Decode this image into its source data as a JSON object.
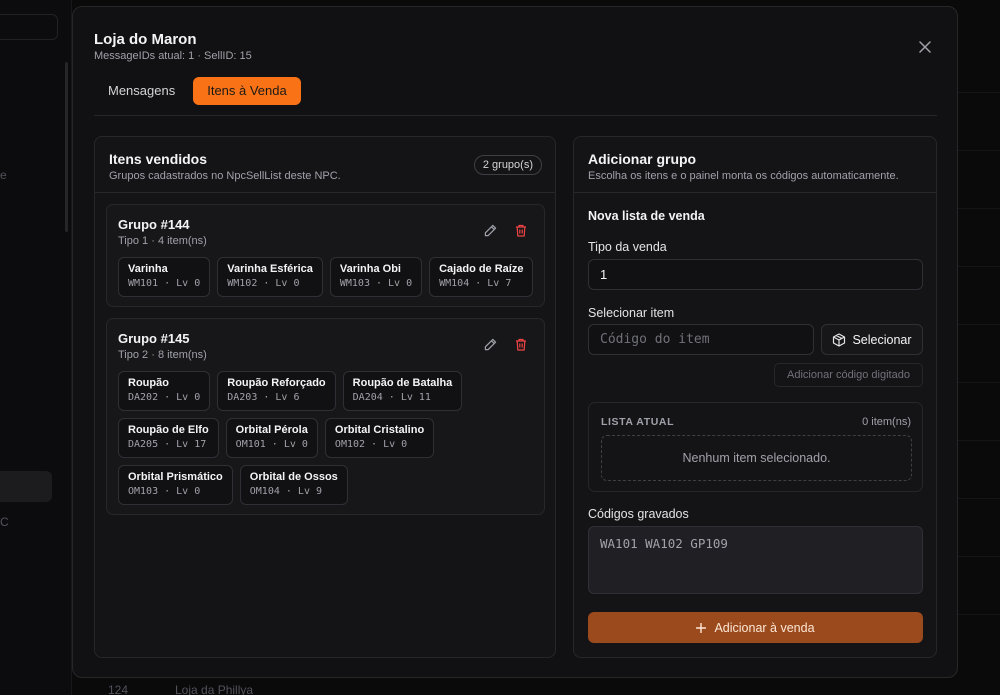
{
  "background": {
    "fragment_left_1": "e",
    "fragment_left_2": "C",
    "row": {
      "id": "124",
      "name": "Loja da Phillya"
    }
  },
  "modal": {
    "title": "Loja do Maron",
    "subtitle": "MessageIDs atual: 1 · SellID: 15",
    "tabs": [
      "Mensagens",
      "Itens à Venda"
    ],
    "active_tab": "Itens à Venda"
  },
  "left": {
    "title": "Itens vendidos",
    "subtitle": "Grupos cadastrados no NpcSellList deste NPC.",
    "badge": "2 grupo(s)",
    "groups": [
      {
        "title": "Grupo #144",
        "subtitle": "Tipo 1 · 4 item(ns)",
        "items": [
          {
            "name": "Varinha",
            "meta": "WM101 · Lv 0"
          },
          {
            "name": "Varinha Esférica",
            "meta": "WM102 · Lv 0"
          },
          {
            "name": "Varinha Obi",
            "meta": "WM103 · Lv 0"
          },
          {
            "name": "Cajado de Raíze",
            "meta": "WM104 · Lv 7"
          }
        ]
      },
      {
        "title": "Grupo #145",
        "subtitle": "Tipo 2 · 8 item(ns)",
        "items": [
          {
            "name": "Roupão",
            "meta": "DA202 · Lv 0"
          },
          {
            "name": "Roupão Reforçado",
            "meta": "DA203 · Lv 6"
          },
          {
            "name": "Roupão de Batalha",
            "meta": "DA204 · Lv 11"
          },
          {
            "name": "Roupão de Elfo",
            "meta": "DA205 · Lv 17"
          },
          {
            "name": "Orbital Pérola",
            "meta": "OM101 · Lv 0"
          },
          {
            "name": "Orbital Cristalino",
            "meta": "OM102 · Lv 0"
          },
          {
            "name": "Orbital Prismático",
            "meta": "OM103 · Lv 0"
          },
          {
            "name": "Orbital de Ossos",
            "meta": "OM104 · Lv 9"
          }
        ]
      }
    ]
  },
  "right": {
    "title": "Adicionar grupo",
    "subtitle": "Escolha os itens e o painel monta os códigos automaticamente.",
    "section_title": "Nova lista de venda",
    "tipo_label": "Tipo da venda",
    "tipo_value": "1",
    "item_label": "Selecionar item",
    "item_placeholder": "Código do item",
    "select_button": "Selecionar",
    "add_code_button": "Adicionar código digitado",
    "list_header": "LISTA ATUAL",
    "list_count": "0 item(ns)",
    "list_empty": "Nenhum item selecionado.",
    "codes_label": "Códigos gravados",
    "codes_placeholder": "WA101 WA102 GP109",
    "submit_button": "Adicionar à venda"
  },
  "colors": {
    "accent": "#f97316",
    "submit": "#9a4a1c",
    "danger": "#ef4444"
  },
  "icons": [
    "close-icon",
    "pencil-icon",
    "trash-icon",
    "package-icon",
    "plus-icon"
  ]
}
